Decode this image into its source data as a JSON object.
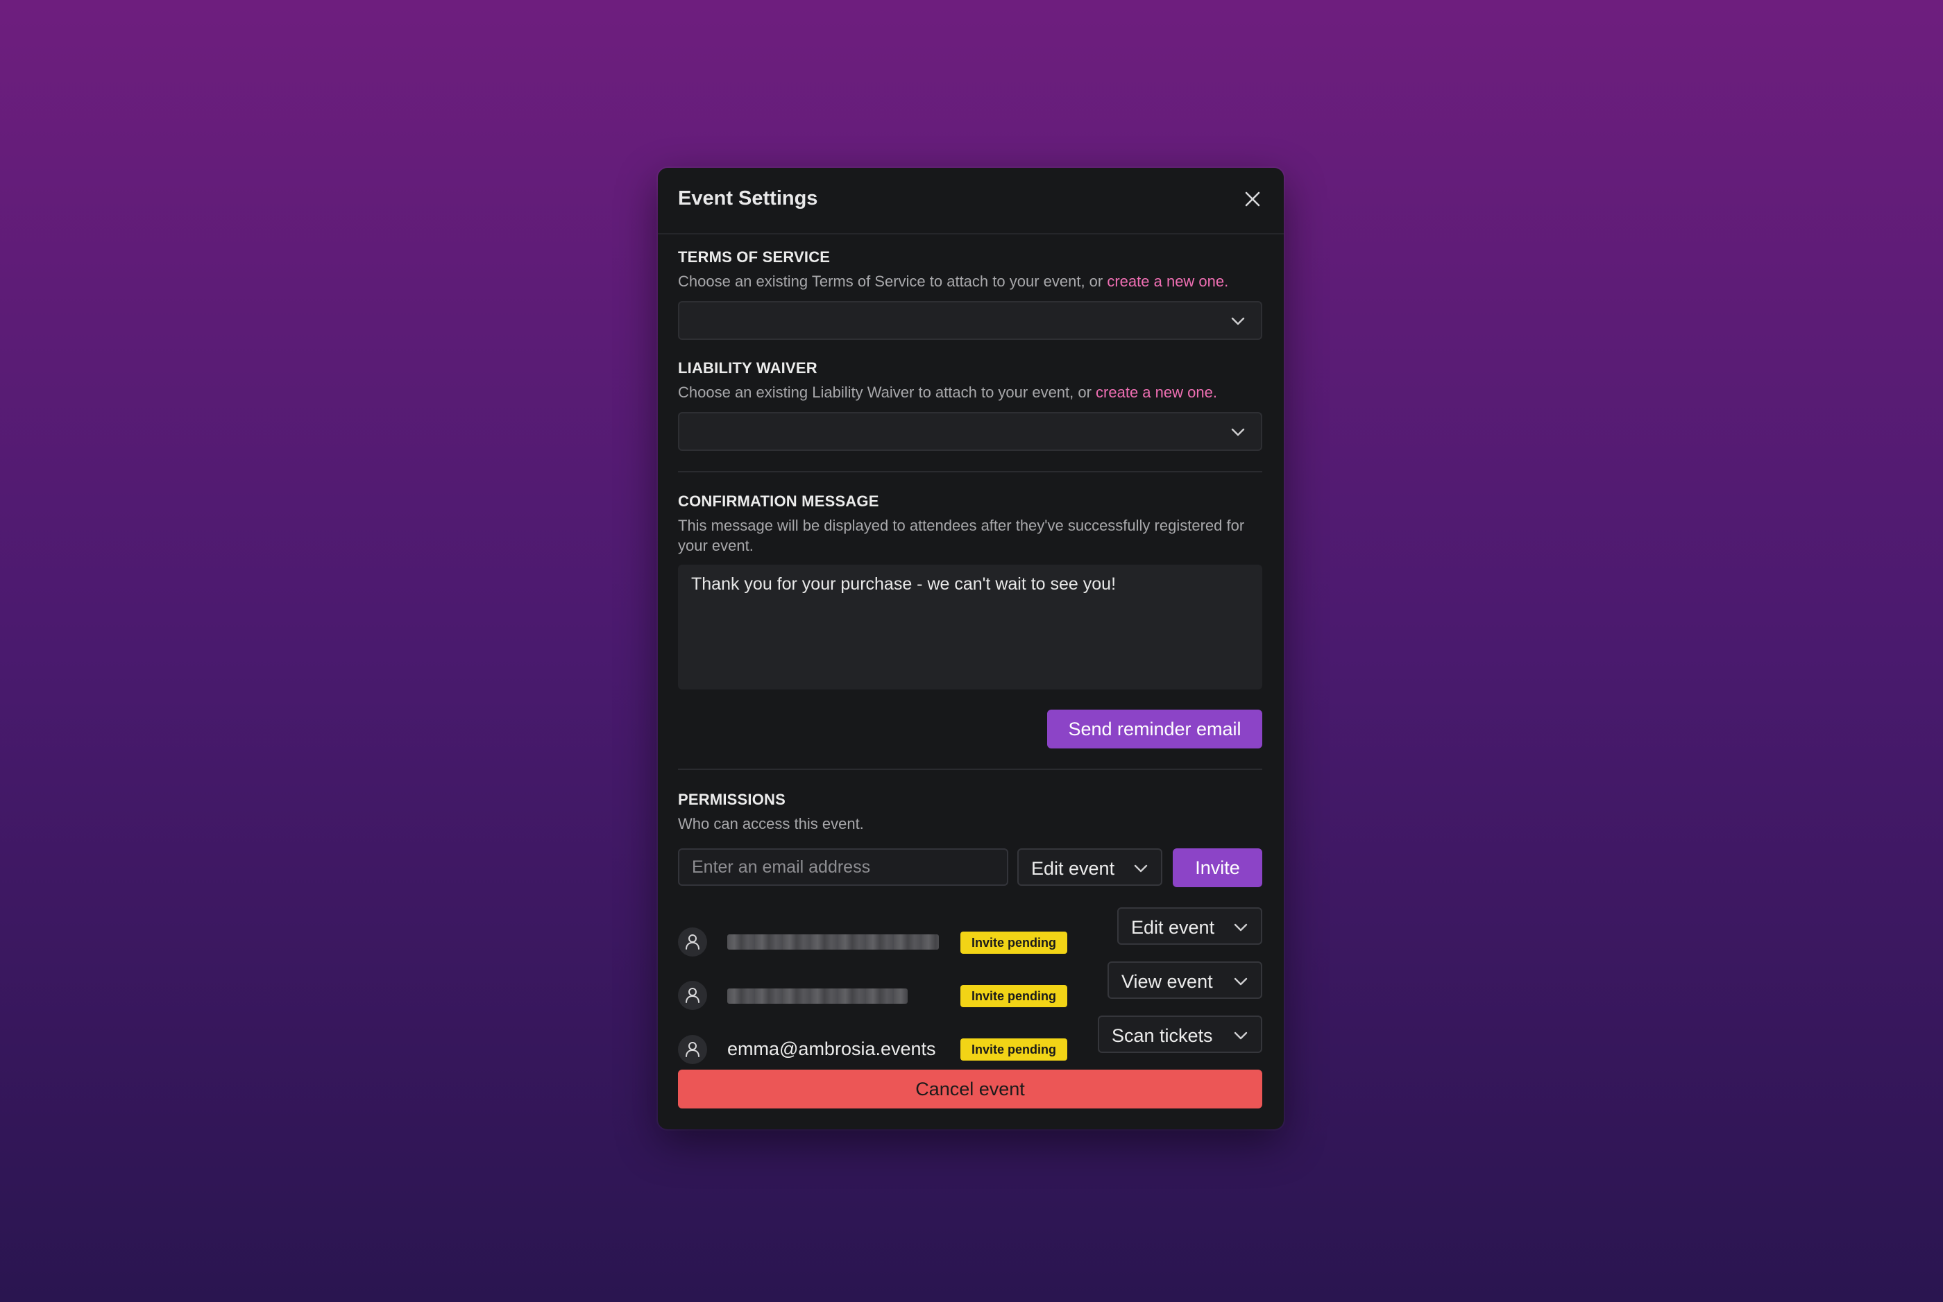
{
  "modal": {
    "title": "Event Settings"
  },
  "terms": {
    "label": "TERMS OF SERVICE",
    "desc": "Choose an existing Terms of Service to attach to your event, or ",
    "link": "create a new one.",
    "selected": ""
  },
  "waiver": {
    "label": "LIABILITY WAIVER",
    "desc": "Choose an existing Liability Waiver to attach to your event, or ",
    "link": "create a new one.",
    "selected": ""
  },
  "confirmation": {
    "label": "CONFIRMATION MESSAGE",
    "desc": "This message will be displayed to attendees after they've successfully registered for your event.",
    "message": "Thank you for your purchase - we can't wait to see you!",
    "reminder_button": "Send reminder email"
  },
  "permissions": {
    "label": "PERMISSIONS",
    "desc": "Who can access this event.",
    "email_placeholder": "Enter an email address",
    "role_select": "Edit event",
    "invite_button": "Invite",
    "members": [
      {
        "email": "",
        "redacted": true,
        "status": "Invite pending",
        "role": "Edit event"
      },
      {
        "email": "",
        "redacted": true,
        "status": "Invite pending",
        "role": "View event"
      },
      {
        "email": "emma@ambrosia.events",
        "redacted": false,
        "status": "Invite pending",
        "role": "Scan tickets"
      }
    ]
  },
  "cancel_button": "Cancel event",
  "colors": {
    "accent": "#8c44c7",
    "danger": "#ec5656",
    "link": "#ef6fb3",
    "badge": "#f2d416"
  }
}
